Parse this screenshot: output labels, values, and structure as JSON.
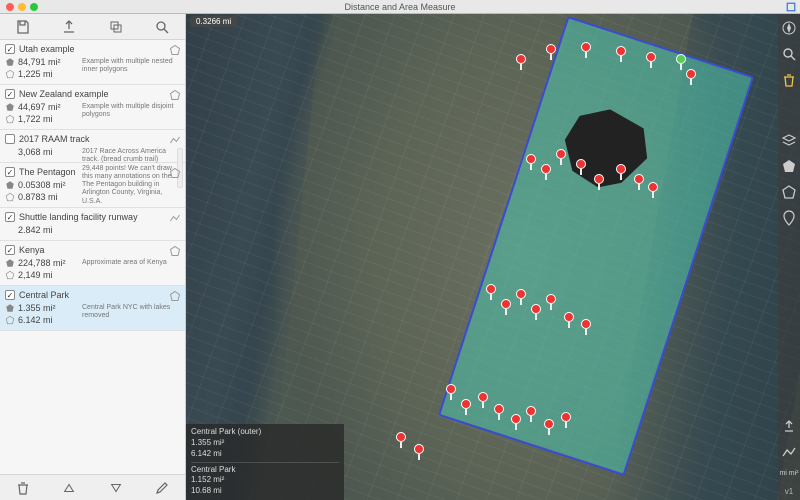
{
  "window": {
    "title": "Distance and Area Measure"
  },
  "sidebar": {
    "top_tools": [
      "save-icon",
      "export-icon",
      "duplicate-icon",
      "search-icon"
    ],
    "bottom_tools": [
      "trash-icon",
      "triangle-up-icon",
      "triangle-down-icon",
      "pencil-icon"
    ],
    "items": [
      {
        "checked": true,
        "title": "Utah example",
        "area": "84,791 mi²",
        "dist": "1,225 mi",
        "desc": "Example with multiple nested inner polygons",
        "badge": "polygon"
      },
      {
        "checked": true,
        "title": "New Zealand example",
        "area": "44,697 mi²",
        "dist": "1,722 mi",
        "desc": "Example with multiple disjoint polygons",
        "badge": "polygon"
      },
      {
        "checked": false,
        "title": "2017 RAAM track",
        "area": "",
        "dist": "3,068 mi",
        "desc": "2017 Race Across America track. (bread crumb trail) 29,448 points! We can't draw this many annotations on the",
        "badge": "path"
      },
      {
        "checked": true,
        "title": "The Pentagon",
        "area": "0.05308 mi²",
        "dist": "0.8783 mi",
        "desc": "The Pentagon building in Arlington County, Virginia, U.S.A.",
        "badge": "polygon"
      },
      {
        "checked": true,
        "title": "Shuttle landing facility runway",
        "area": "",
        "dist": "2.842 mi",
        "desc": "",
        "badge": "path"
      },
      {
        "checked": true,
        "title": "Kenya",
        "area": "224,788 mi²",
        "dist": "2,149 mi",
        "desc": "Approximate area of Kenya",
        "badge": "polygon"
      },
      {
        "checked": true,
        "title": "Central Park",
        "area": "1.355 mi²",
        "dist": "6.142 mi",
        "desc": "Central Park NYC with lakes removed",
        "badge": "polygon",
        "selected": true
      }
    ]
  },
  "map": {
    "scale_label": "0.3266 mi",
    "readout": {
      "r1_label": "Central Park (outer)",
      "r1_area": "1.355 mi²",
      "r1_dist": "6.142 mi",
      "r2_label": "Central Park",
      "r2_area": "1.152 mi²",
      "r2_dist": "10.68 mi"
    },
    "right_tools": [
      "compass-icon",
      "search-icon",
      "trash-icon",
      "layers-icon",
      "polygon-icon",
      "polygon-outline-icon",
      "marker-icon",
      "share-icon",
      "path-icon",
      "unit-toggle"
    ],
    "version_label": "v1",
    "unit_label": "mi mi²"
  }
}
